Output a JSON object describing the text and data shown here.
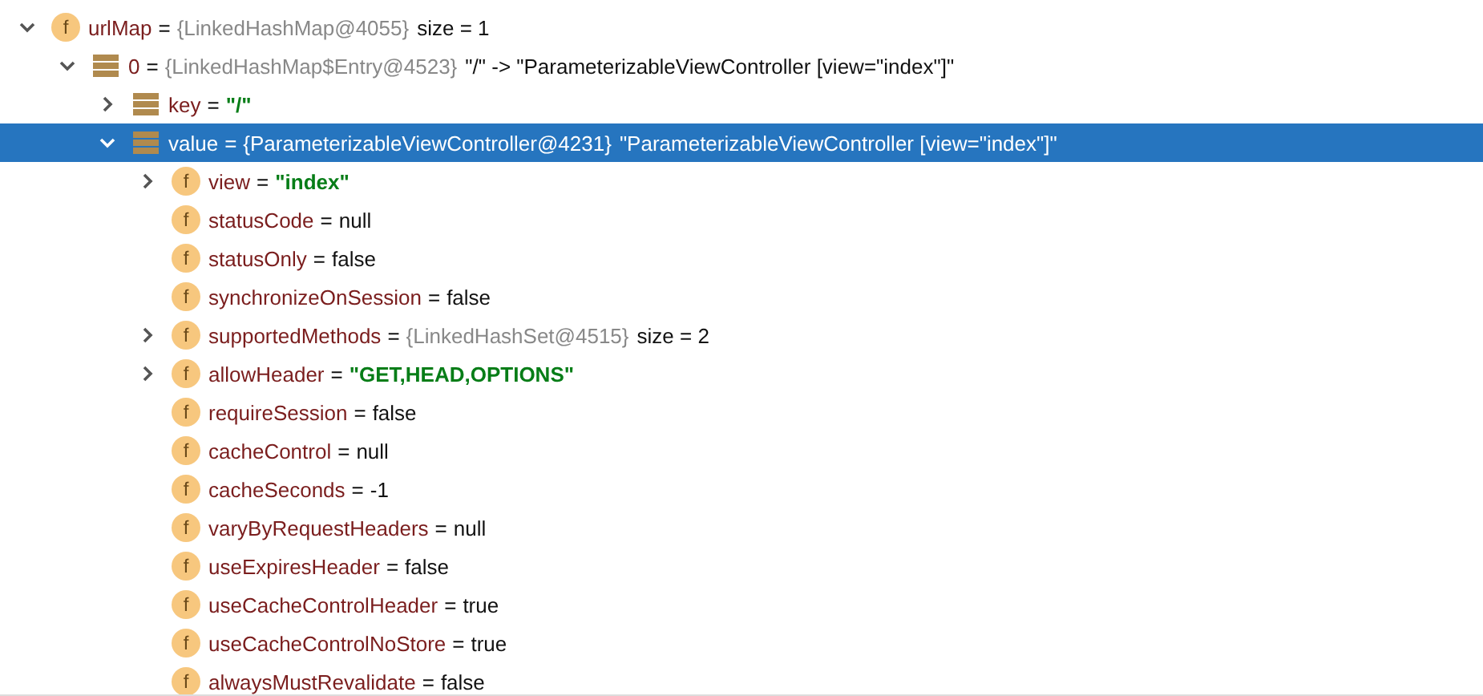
{
  "variables": [
    {
      "kind": "field",
      "badge": "f",
      "name": "urlMap",
      "sep": "=",
      "ref": "{LinkedHashMap@4055}",
      "value": "size = 1",
      "expanded": true,
      "selected": false,
      "children": [
        {
          "kind": "entry",
          "name": "0",
          "sep": "=",
          "ref": "{LinkedHashMap$Entry@4523}",
          "value": "\"/\" -> \"ParameterizableViewController [view=\"index\"]\"",
          "expanded": true,
          "selected": false,
          "children": [
            {
              "kind": "entry",
              "name": "key",
              "sep": "=",
              "string": "\"/\"",
              "expanded": false,
              "selected": false
            },
            {
              "kind": "entry",
              "name": "value",
              "sep": "=",
              "ref": "{ParameterizableViewController@4231}",
              "value": "\"ParameterizableViewController [view=\"index\"]\"",
              "expanded": true,
              "selected": true,
              "children": [
                {
                  "kind": "field",
                  "badge": "f",
                  "name": "view",
                  "sep": "=",
                  "string": "\"index\"",
                  "expanded": false,
                  "selected": false
                },
                {
                  "kind": "field",
                  "badge": "f",
                  "name": "statusCode",
                  "sep": "=",
                  "value": "null",
                  "selected": false
                },
                {
                  "kind": "field",
                  "badge": "f",
                  "name": "statusOnly",
                  "sep": "=",
                  "value": "false",
                  "selected": false
                },
                {
                  "kind": "field",
                  "badge": "f",
                  "name": "synchronizeOnSession",
                  "sep": "=",
                  "value": "false",
                  "selected": false
                },
                {
                  "kind": "field",
                  "badge": "f",
                  "name": "supportedMethods",
                  "sep": "=",
                  "ref": "{LinkedHashSet@4515}",
                  "value": "size = 2",
                  "expanded": false,
                  "selected": false
                },
                {
                  "kind": "field",
                  "badge": "f",
                  "name": "allowHeader",
                  "sep": "=",
                  "string": "\"GET,HEAD,OPTIONS\"",
                  "expanded": false,
                  "selected": false
                },
                {
                  "kind": "field",
                  "badge": "f",
                  "name": "requireSession",
                  "sep": "=",
                  "value": "false",
                  "selected": false
                },
                {
                  "kind": "field",
                  "badge": "f",
                  "name": "cacheControl",
                  "sep": "=",
                  "value": "null",
                  "selected": false
                },
                {
                  "kind": "field",
                  "badge": "f",
                  "name": "cacheSeconds",
                  "sep": "=",
                  "value": "-1",
                  "selected": false
                },
                {
                  "kind": "field",
                  "badge": "f",
                  "name": "varyByRequestHeaders",
                  "sep": "=",
                  "value": "null",
                  "selected": false
                },
                {
                  "kind": "field",
                  "badge": "f",
                  "name": "useExpiresHeader",
                  "sep": "=",
                  "value": "false",
                  "selected": false
                },
                {
                  "kind": "field",
                  "badge": "f",
                  "name": "useCacheControlHeader",
                  "sep": "=",
                  "value": "true",
                  "selected": false
                },
                {
                  "kind": "field",
                  "badge": "f",
                  "name": "useCacheControlNoStore",
                  "sep": "=",
                  "value": "true",
                  "selected": false
                },
                {
                  "kind": "field",
                  "badge": "f",
                  "name": "alwaysMustRevalidate",
                  "sep": "=",
                  "value": "false",
                  "selected": false
                }
              ]
            }
          ]
        }
      ]
    }
  ]
}
